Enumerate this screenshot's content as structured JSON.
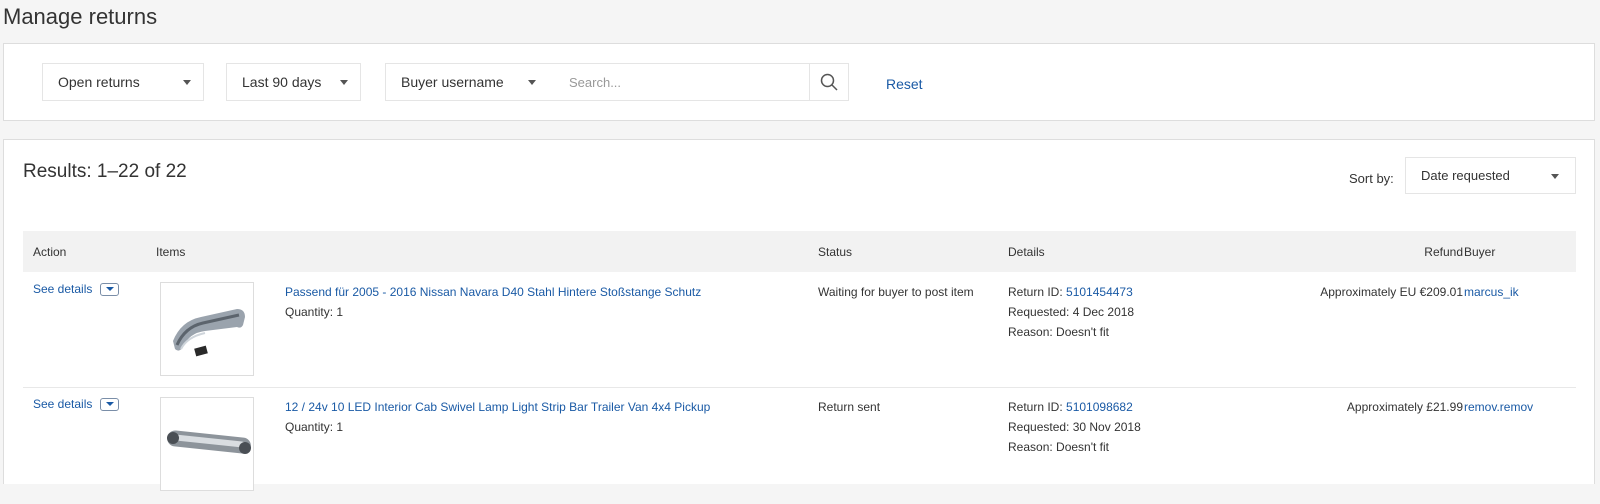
{
  "page": {
    "title": "Manage returns"
  },
  "filters": {
    "status": "Open returns",
    "period": "Last 90 days",
    "search_by": "Buyer username",
    "search_placeholder": "Search...",
    "reset": "Reset"
  },
  "results": {
    "count_label": "Results: 1–22 of 22",
    "sort_label": "Sort by:",
    "sort_value": "Date requested"
  },
  "table": {
    "headers": {
      "action": "Action",
      "items": "Items",
      "status": "Status",
      "details": "Details",
      "refund": "Refund",
      "buyer": "Buyer"
    },
    "rows": [
      {
        "action": "See details",
        "item_title": "Passend für 2005 - 2016 Nissan Navara D40 Stahl Hintere Stoßstange Schutz",
        "quantity": "Quantity: 1",
        "status": "Waiting for buyer to post item",
        "return_id_label": "Return ID:",
        "return_id": "5101454473",
        "requested": "Requested: 4 Dec 2018",
        "reason": "Reason: Doesn't fit",
        "refund": "Approximately EU €209.01",
        "buyer": "marcus_ik"
      },
      {
        "action": "See details",
        "item_title": "12 / 24v 10 LED Interior Cab Swivel Lamp Light Strip Bar Trailer Van 4x4 Pickup",
        "quantity": "Quantity: 1",
        "status": "Return sent",
        "return_id_label": "Return ID:",
        "return_id": "5101098682",
        "requested": "Requested: 30 Nov 2018",
        "reason": "Reason: Doesn't fit",
        "refund": "Approximately £21.99",
        "buyer": "remov.remov"
      }
    ]
  },
  "icons": {
    "dropdown": "chevron-down-icon",
    "search": "search-icon"
  },
  "colors": {
    "link": "#1a5aa5",
    "header_bg": "#f2f2f2",
    "page_bg": "#f5f5f5"
  }
}
